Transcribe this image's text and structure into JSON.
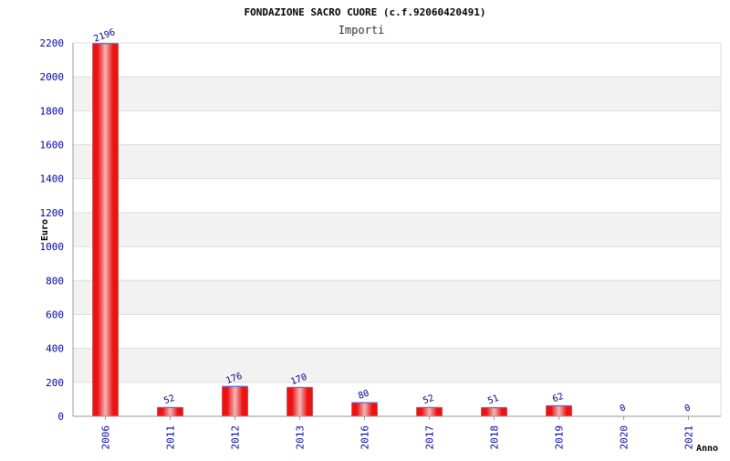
{
  "chart_data": {
    "type": "bar",
    "title": "FONDAZIONE SACRO CUORE (c.f.92060420491)",
    "subtitle": "Importi",
    "xlabel": "Anno",
    "ylabel": "Euro",
    "categories": [
      "2006",
      "2011",
      "2012",
      "2013",
      "2016",
      "2017",
      "2018",
      "2019",
      "2020",
      "2021"
    ],
    "series": [
      {
        "values": [
          2196,
          52,
          176,
          170,
          80,
          52,
          51,
          62,
          0,
          0
        ]
      }
    ],
    "data_labels": [
      "2196",
      "52",
      "176",
      "170",
      "80",
      "52",
      "51",
      "62",
      "0",
      "0"
    ],
    "ylim": [
      0,
      2200
    ],
    "yticks": [
      "0",
      "200",
      "400",
      "600",
      "800",
      "1000",
      "1200",
      "1400",
      "1600",
      "1800",
      "2000",
      "2200"
    ],
    "grid": true,
    "colors": {
      "bar": "#ee1111",
      "bar_highlight": "#f0b8b8",
      "band": "#f2f2f2",
      "tick_text": "#0000aa"
    }
  }
}
